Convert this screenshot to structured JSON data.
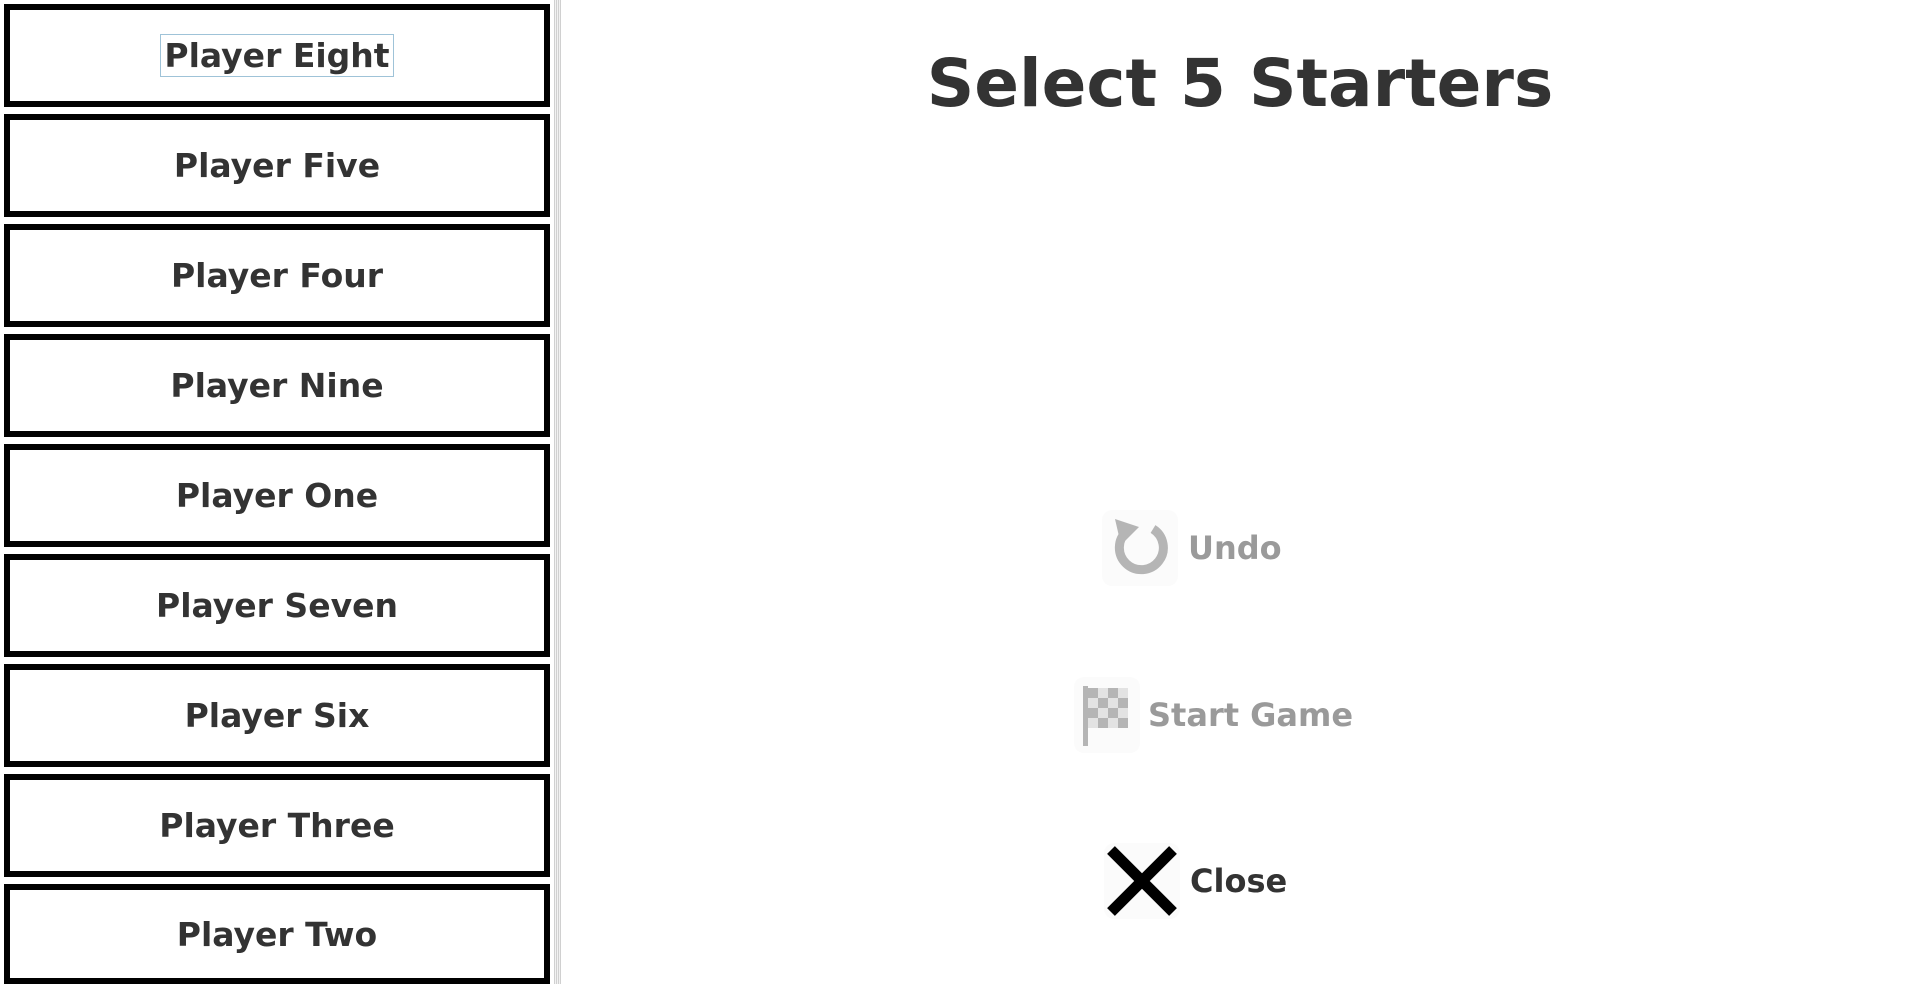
{
  "roster": {
    "players": [
      {
        "label": "Player Eight",
        "focused": true
      },
      {
        "label": "Player Five"
      },
      {
        "label": "Player Four"
      },
      {
        "label": "Player Nine"
      },
      {
        "label": "Player One"
      },
      {
        "label": "Player Seven"
      },
      {
        "label": "Player Six"
      },
      {
        "label": "Player Three"
      },
      {
        "label": "Player Two"
      }
    ]
  },
  "main": {
    "title": "Select 5 Starters",
    "actions": {
      "undo": {
        "label": "Undo",
        "icon": "undo-icon",
        "enabled": false
      },
      "start_game": {
        "label": "Start Game",
        "icon": "checkered-flag-icon",
        "enabled": false
      },
      "close": {
        "label": "Close",
        "icon": "close-icon",
        "enabled": true
      }
    }
  },
  "colors": {
    "text": "#333333",
    "disabled_text": "#9a9a9a",
    "disabled_icon": "#b5b5b5",
    "border": "#000000",
    "focus_outline": "#9fc3d8"
  }
}
